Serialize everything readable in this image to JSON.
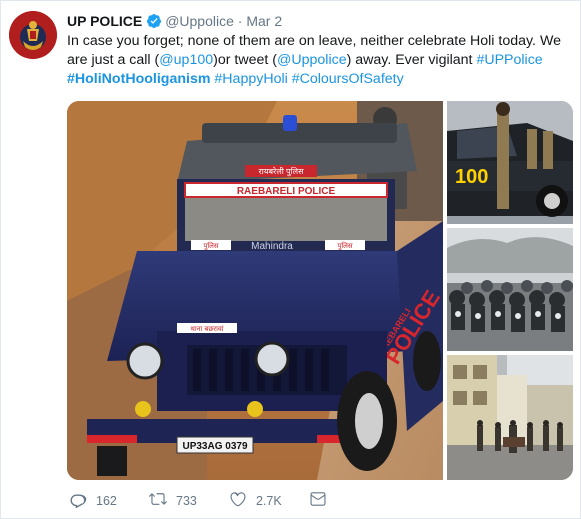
{
  "tweet": {
    "display_name": "UP POLICE",
    "handle": "@Uppolice",
    "separator": "·",
    "date": "Mar 2",
    "text": {
      "line1": "In case you forget; none of them are on leave, neither celebrate Holi today. We",
      "line2_a": "are just a call (",
      "mention1": "@up100",
      "line2_b": ")or tweet (",
      "mention2": "@Uppolice",
      "line2_c": ") away. Ever vigilant ",
      "tag1": "#UPPolice",
      "tag2": "#HoliNotHooliganism",
      "tag3": "#HappyHoli",
      "tag4": "#ColoursOfSafety"
    },
    "media": {
      "main_photo": {
        "vehicle_label": "RAEBARELI POLICE",
        "roof_sign": "रायबरेली पुलिस",
        "side_label_1": "RAEBARELI",
        "side_label_2": "POLICE",
        "grille_brand": "Mahindra",
        "plate": "UP33AG 0379",
        "hood_sign_left": "पुलिस",
        "hood_sign_right": "पुलिस",
        "bumper_sign": "थाना बछरावां"
      },
      "top_right_photo": {
        "car_text": "100"
      }
    },
    "actions": {
      "replies": "162",
      "retweets": "733",
      "likes": "2.7K"
    },
    "colors": {
      "link": "#1b95e0",
      "muted": "#657786",
      "verified": "#1da1f2"
    },
    "icons": [
      "reply-icon",
      "retweet-icon",
      "like-icon",
      "direct-message-icon",
      "verified-badge-icon"
    ]
  }
}
